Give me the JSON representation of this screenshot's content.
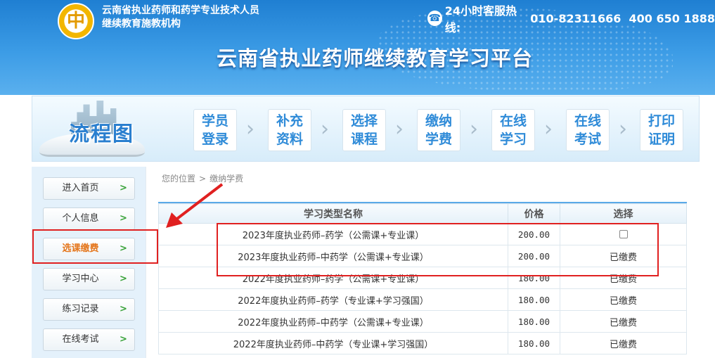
{
  "header": {
    "org_line1": "云南省执业药师和药学专业技术人员",
    "org_line2": "继续教育施教机构",
    "hotline_label": "24小时客服热线:",
    "hotline_numbers": "010-82311666  400 650 1888",
    "site_title": "云南省执业药师继续教育学习平台",
    "logo_glyph": "中"
  },
  "flow": {
    "title": "流程图",
    "steps": [
      {
        "line1": "学员",
        "line2": "登录"
      },
      {
        "line1": "补充",
        "line2": "资料"
      },
      {
        "line1": "选择",
        "line2": "课程"
      },
      {
        "line1": "缴纳",
        "line2": "学费"
      },
      {
        "line1": "在线",
        "line2": "学习"
      },
      {
        "line1": "在线",
        "line2": "考试"
      },
      {
        "line1": "打印",
        "line2": "证明"
      }
    ]
  },
  "sidebar": {
    "items": [
      {
        "label": "进入首页",
        "active": false
      },
      {
        "label": "个人信息",
        "active": false
      },
      {
        "label": "选课缴费",
        "active": true
      },
      {
        "label": "学习中心",
        "active": false
      },
      {
        "label": "练习记录",
        "active": false
      },
      {
        "label": "在线考试",
        "active": false
      }
    ],
    "arrow_glyph": ">"
  },
  "breadcrumb": {
    "prefix": "您的位置",
    "separator": ">",
    "current": "缴纳学费"
  },
  "table": {
    "headers": [
      "学习类型名称",
      "价格",
      "选择"
    ],
    "rows": [
      {
        "name": "2023年度执业药师–药学（公需课+专业课）",
        "price": "200.00",
        "status": "",
        "checkbox": true
      },
      {
        "name": "2023年度执业药师–中药学（公需课+专业课）",
        "price": "200.00",
        "status": "已缴费",
        "checkbox": false
      },
      {
        "name": "2022年度执业药师–药学（公需课+专业课）",
        "price": "180.00",
        "status": "已缴费",
        "checkbox": false
      },
      {
        "name": "2022年度执业药师–药学（专业课+学习强国）",
        "price": "180.00",
        "status": "已缴费",
        "checkbox": false
      },
      {
        "name": "2022年度执业药师–中药学（公需课+专业课）",
        "price": "180.00",
        "status": "已缴费",
        "checkbox": false
      },
      {
        "name": "2022年度执业药师–中药学（专业课+学习强国）",
        "price": "180.00",
        "status": "已缴费",
        "checkbox": false
      }
    ]
  },
  "colors": {
    "header_blue": "#1f7fd2",
    "active_orange": "#e4751a",
    "annotation_red": "#e02020",
    "nav_arrow_green": "#3aa33a"
  }
}
